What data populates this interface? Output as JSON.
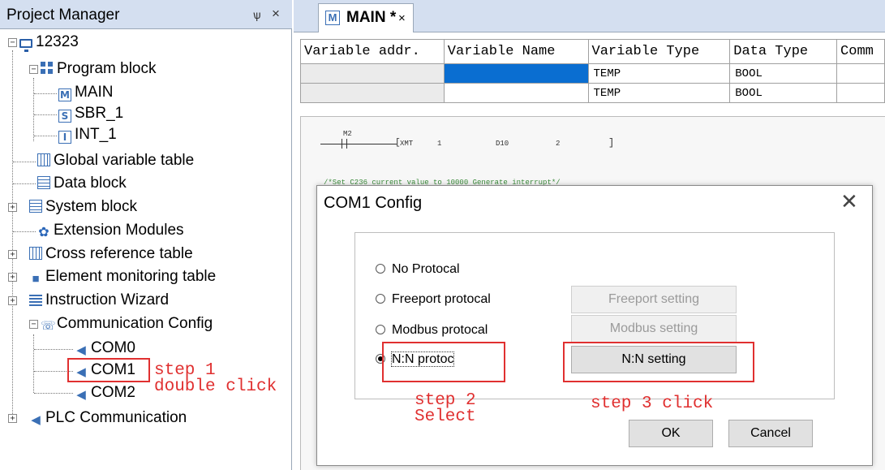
{
  "project_manager": {
    "title": "Project Manager",
    "pin_glyph": "ѱ",
    "close_glyph": "×",
    "tree": {
      "root": "12323",
      "program_block": "Program block",
      "main": "MAIN",
      "sbr": "SBR_1",
      "int": "INT_1",
      "global_var": "Global variable table",
      "data_block": "Data block",
      "system_block": "System block",
      "ext_modules": "Extension Modules",
      "cross_ref": "Cross reference table",
      "element_monitor": "Element monitoring table",
      "instr_wizard": "Instruction Wizard",
      "comm_config": "Communication Config",
      "com0": "COM0",
      "com1": "COM1",
      "com2": "COM2",
      "plc_comm": "PLC Communication"
    },
    "expand_plus": "+",
    "expand_minus": "−"
  },
  "tab": {
    "icon_letter": "M",
    "label": "MAIN *",
    "close": "×"
  },
  "var_table": {
    "headers": [
      "Variable addr.",
      "Variable Name",
      "Variable Type",
      "Data Type",
      "Comm"
    ],
    "rows": [
      [
        "",
        "",
        "TEMP",
        "BOOL",
        ""
      ],
      [
        "",
        "",
        "TEMP",
        "BOOL",
        ""
      ]
    ]
  },
  "ladder": {
    "contact": "M2",
    "instr": "XMT",
    "arg1": "1",
    "arg2": "D10",
    "arg3": "2",
    "bracket": "]",
    "comment": "/*Set C236 current value to 10000 Generate interrupt*/"
  },
  "dialog": {
    "title": "COM1 Config",
    "close": "✕",
    "radios": [
      {
        "label": "No Protocal",
        "checked": false
      },
      {
        "label": "Freeport protocal",
        "checked": false
      },
      {
        "label": "Modbus protocal",
        "checked": false
      },
      {
        "label": "N:N protoc",
        "checked": true
      }
    ],
    "buttons": {
      "freeport_setting": "Freeport setting",
      "modbus_setting": "Modbus setting",
      "nn_setting": "N:N setting",
      "ok": "OK",
      "cancel": "Cancel"
    }
  },
  "annotations": {
    "step1": "step 1\ndouble click",
    "step2": "step 2\nSelect",
    "step3": "step 3 click",
    "color": "#e03030"
  },
  "colors": {
    "header_bg": "#d4dff0",
    "selection": "#0a6ed1",
    "icon_blue": "#3a6fb5"
  }
}
